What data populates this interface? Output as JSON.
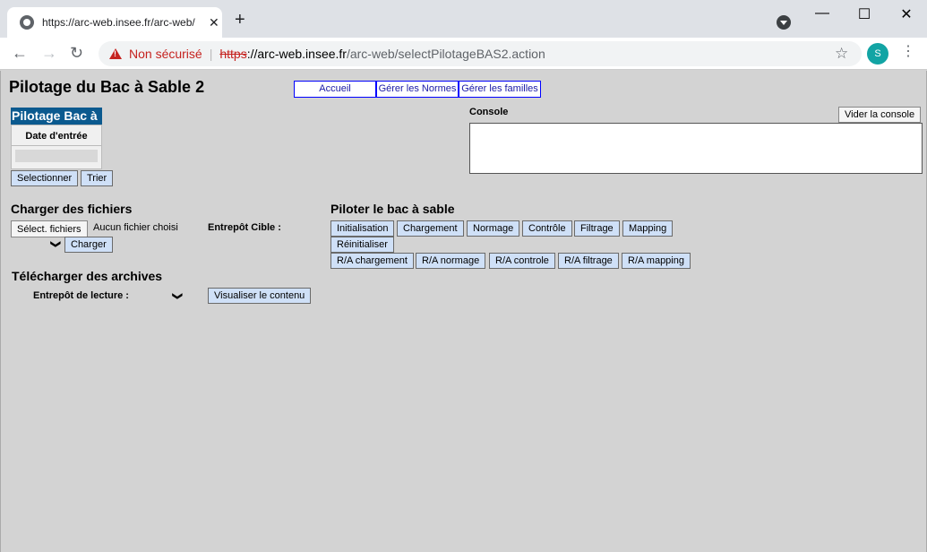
{
  "browser": {
    "tab_title": "https://arc-web.insee.fr/arc-web/",
    "tab_close": "✕",
    "new_tab": "+",
    "win_minimize": "—",
    "win_maximize": "☐",
    "win_close": "✕",
    "back": "←",
    "forward": "→",
    "reload": "↻",
    "security_label": "Non sécurisé",
    "url_scheme": "https",
    "url_host": "://arc-web.insee.fr",
    "url_path": "/arc-web/selectPilotageBAS2.action",
    "star": "☆",
    "avatar_letter": "S",
    "menu": "⋮"
  },
  "page": {
    "title": "Pilotage du Bac à Sable 2",
    "nav": [
      "Accueil",
      "Gérer les Normes",
      "Gérer les familles"
    ],
    "panel": {
      "header": "Pilotage Bac à",
      "column": "Date d'entrée",
      "select_btn": "Selectionner",
      "sort_btn": "Trier"
    },
    "console": {
      "label": "Console",
      "clear_btn": "Vider la console"
    },
    "upload": {
      "heading": "Charger des fichiers",
      "file_btn": "Sélect. fichiers",
      "file_status": "Aucun fichier choisi",
      "target_label": "Entrepôt Cible :",
      "load_btn": "Charger",
      "chevron": "❯"
    },
    "archives": {
      "heading": "Télécharger des archives",
      "read_label": "Entrepôt de lecture :",
      "view_btn": "Visualiser le contenu",
      "chevron": "❯"
    },
    "sandbox": {
      "heading": "Piloter le bac à sable",
      "row1": [
        "Initialisation",
        "Chargement",
        "Normage",
        "Contrôle",
        "Filtrage",
        "Mapping"
      ],
      "reset_btn": "Réinitialiser",
      "row3": [
        "R/A chargement",
        "R/A normage",
        "R/A controle",
        "R/A filtrage",
        "R/A mapping"
      ]
    }
  }
}
